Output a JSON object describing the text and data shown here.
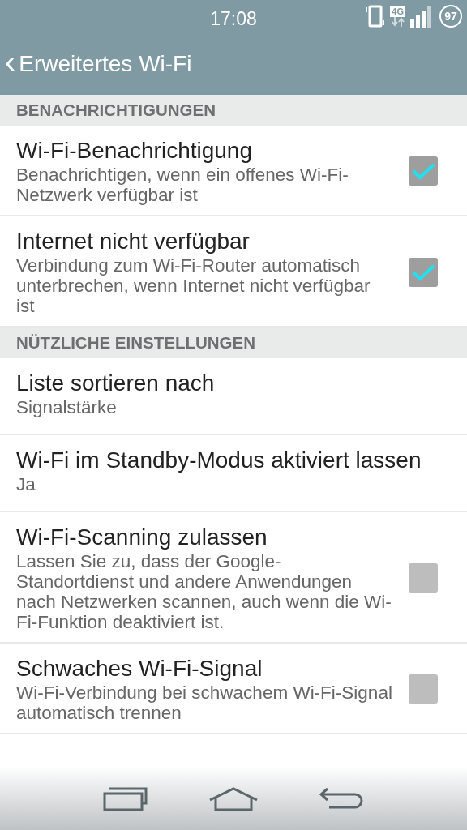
{
  "status_bar": {
    "time": "17:08",
    "network": "4G",
    "battery": "97"
  },
  "header": {
    "back": "‹",
    "title": "Erweitertes Wi-Fi"
  },
  "sections": [
    {
      "title": "BENACHRICHTIGUNGEN",
      "items": [
        {
          "kind": "checkbox",
          "title": "Wi-Fi-Benachrichtigung",
          "summary": "Benachrichtigen, wenn ein offenes Wi-Fi-Netzwerk verfügbar ist",
          "checked": true
        },
        {
          "kind": "checkbox",
          "title": "Internet nicht verfügbar",
          "summary": "Verbindung zum Wi-Fi-Router automatisch unterbrechen, wenn Internet nicht verfügbar ist",
          "checked": true
        }
      ]
    },
    {
      "title": "NÜTZLICHE EINSTELLUNGEN",
      "items": [
        {
          "kind": "value",
          "title": "Liste sortieren nach",
          "summary": "Signalstärke"
        },
        {
          "kind": "value",
          "title": "Wi-Fi im Standby-Modus aktiviert lassen",
          "summary": "Ja"
        },
        {
          "kind": "checkbox",
          "title": "Wi-Fi-Scanning zulassen",
          "summary": "Lassen Sie zu, dass der Google-Standortdienst und andere Anwendungen nach Netzwerken scannen, auch wenn die Wi-Fi-Funktion deaktiviert ist.",
          "checked": false
        },
        {
          "kind": "checkbox",
          "title": "Schwaches Wi-Fi-Signal",
          "summary": "Wi-Fi-Verbindung bei schwachem Wi-Fi-Signal automatisch trennen",
          "checked": false
        }
      ]
    }
  ]
}
